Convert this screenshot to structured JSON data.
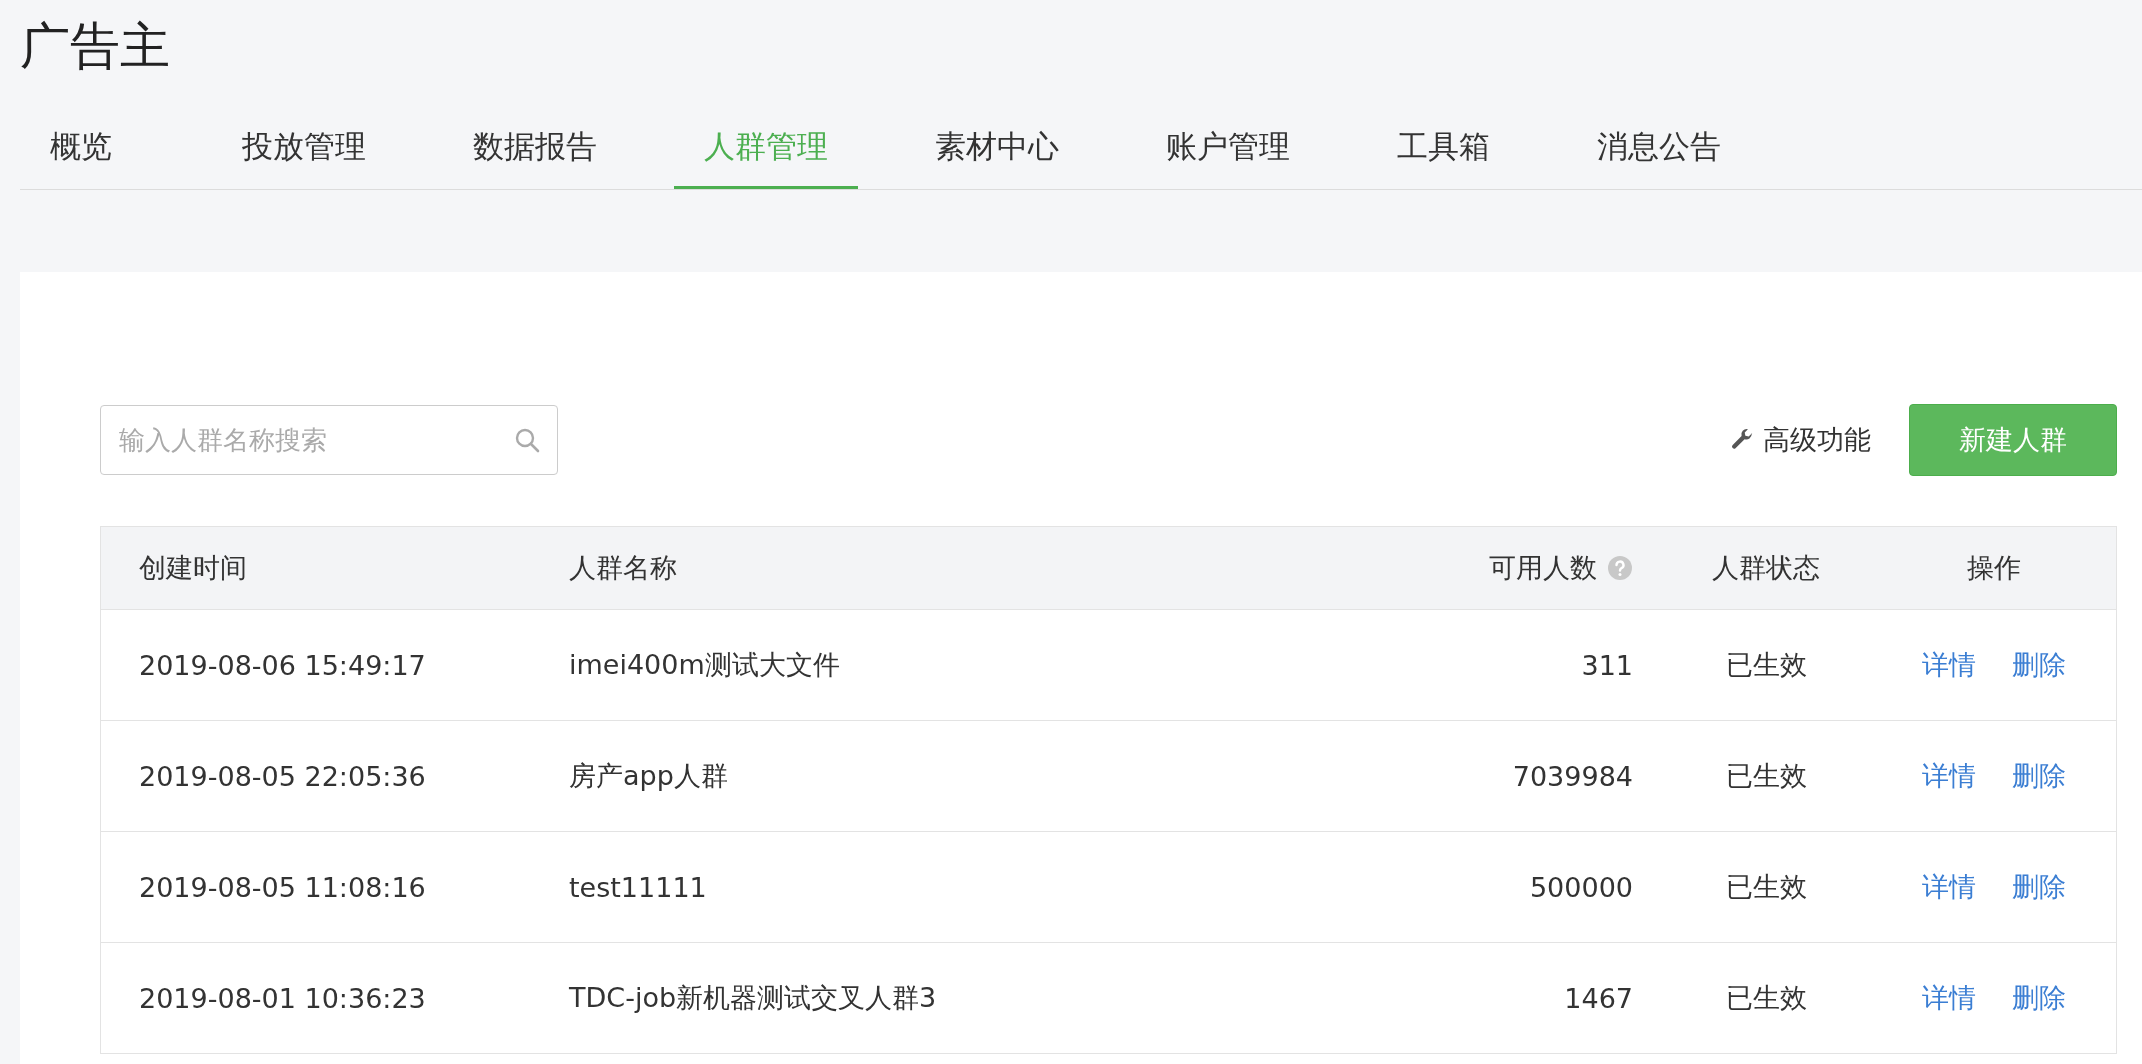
{
  "header": {
    "title": "广告主"
  },
  "tabs": [
    {
      "label": "概览",
      "selected": false
    },
    {
      "label": "投放管理",
      "selected": false
    },
    {
      "label": "数据报告",
      "selected": false
    },
    {
      "label": "人群管理",
      "selected": true
    },
    {
      "label": "素材中心",
      "selected": false
    },
    {
      "label": "账户管理",
      "selected": false
    },
    {
      "label": "工具箱",
      "selected": false
    },
    {
      "label": "消息公告",
      "selected": false
    }
  ],
  "toolbar": {
    "search": {
      "placeholder": "输入人群名称搜索"
    },
    "advanced_link": "高级功能",
    "create_button": "新建人群"
  },
  "table": {
    "columns": [
      {
        "label": "创建时间",
        "help": false
      },
      {
        "label": "人群名称",
        "help": false
      },
      {
        "label": "可用人数",
        "help": true
      },
      {
        "label": "人群状态",
        "help": false
      },
      {
        "label": "操作",
        "help": false
      }
    ],
    "rows": [
      {
        "created": "2019-08-06 15:49:17",
        "name": "imei400m测试大文件",
        "count": "311",
        "status": "已生效",
        "actions": [
          "详情",
          "删除"
        ]
      },
      {
        "created": "2019-08-05 22:05:36",
        "name": "房产app人群",
        "count": "7039984",
        "status": "已生效",
        "actions": [
          "详情",
          "删除"
        ]
      },
      {
        "created": "2019-08-05 11:08:16",
        "name": "test11111",
        "count": "500000",
        "status": "已生效",
        "actions": [
          "详情",
          "删除"
        ]
      },
      {
        "created": "2019-08-01 10:36:23",
        "name": "TDC-job新机器测试交叉人群3",
        "count": "1467",
        "status": "已生效",
        "actions": [
          "详情",
          "删除"
        ]
      }
    ]
  }
}
